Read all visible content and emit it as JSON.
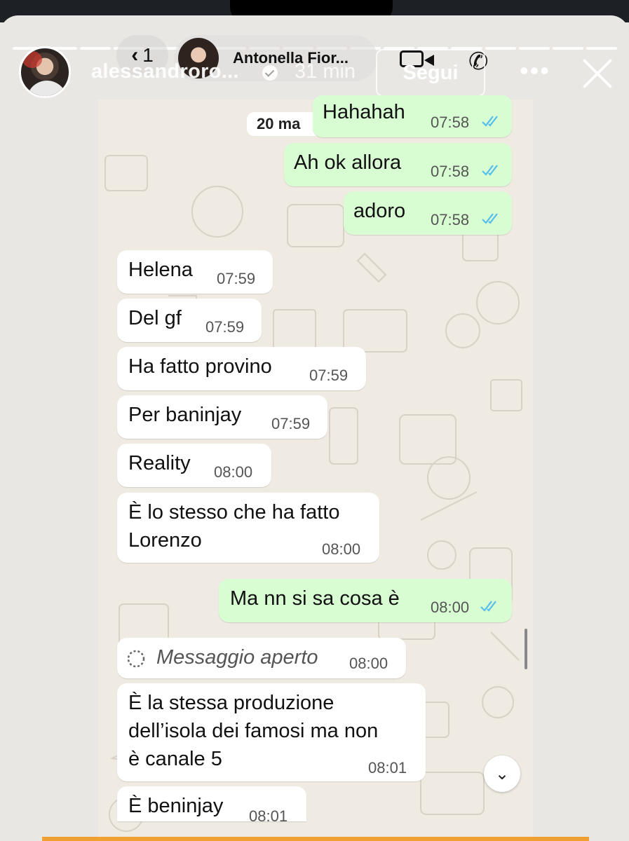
{
  "story": {
    "username": "alessandroro...",
    "time_ago": "31 min",
    "follow_label": "Segui",
    "more_icon": "more-horizontal-icon",
    "close_icon": "close-icon",
    "progress_segments": 18
  },
  "whatsapp_header": {
    "back_count": "1",
    "contact_name": "Antonella Fior...",
    "date_chip": "20 ma"
  },
  "messages": [
    {
      "side": "out",
      "text": "Hahahah",
      "time": "07:58",
      "read": true
    },
    {
      "side": "out",
      "text": "Ah ok allora",
      "time": "07:58",
      "read": true
    },
    {
      "side": "out",
      "text": "adoro",
      "time": "07:58",
      "read": true
    },
    {
      "side": "in",
      "text": "Helena",
      "time": "07:59"
    },
    {
      "side": "in",
      "text": "Del gf",
      "time": "07:59"
    },
    {
      "side": "in",
      "text": "Ha fatto provino",
      "time": "07:59"
    },
    {
      "side": "in",
      "text": "Per baninjay",
      "time": "07:59"
    },
    {
      "side": "in",
      "text": "Reality",
      "time": "08:00"
    },
    {
      "side": "in",
      "text": "È lo stesso che ha fatto\nLorenzo",
      "time": "08:00"
    },
    {
      "side": "out",
      "text": "Ma nn si sa cosa è",
      "time": "08:00",
      "read": true
    },
    {
      "side": "in",
      "text": "Messaggio aperto",
      "time": "08:00",
      "view_once": true
    },
    {
      "side": "in",
      "text": "È la stessa produzione\ndell’isola dei famosi ma non\nè canale 5",
      "time": "08:01"
    },
    {
      "side": "in",
      "text": "È beninjay",
      "time": "08:01"
    }
  ],
  "colors": {
    "outgoing_bubble": "#d9fdd3",
    "incoming_bubble": "#ffffff",
    "read_ticks": "#53bdeb",
    "chat_wallpaper": "#efeae2"
  }
}
